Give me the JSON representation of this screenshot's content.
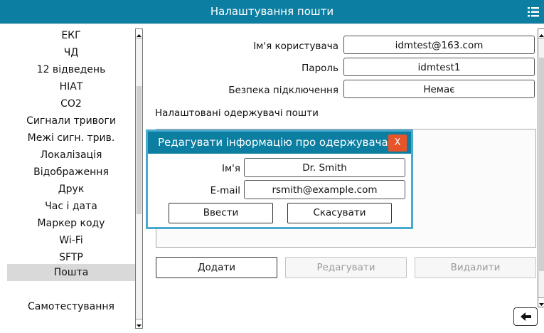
{
  "header": {
    "title": "Налаштування пошти",
    "menu_icon": "list-menu-icon"
  },
  "sidebar": {
    "items": [
      {
        "label": "ЕКГ"
      },
      {
        "label": "ЧД"
      },
      {
        "label": "12 відведень"
      },
      {
        "label": "НІАТ"
      },
      {
        "label": "CO2"
      },
      {
        "label": "Сигнали тривоги"
      },
      {
        "label": "Межі сигн. трив."
      },
      {
        "label": "Локалізація"
      },
      {
        "label": "Відображення"
      },
      {
        "label": "Друк"
      },
      {
        "label": "Час і дата"
      },
      {
        "label": "Маркер коду"
      },
      {
        "label": "Wi-Fi"
      },
      {
        "label": "SFTP"
      },
      {
        "label": "Пошта"
      },
      {
        "label": "Самотестування"
      }
    ],
    "active_item": "Пошта"
  },
  "account": {
    "username_label": "Ім'я користувача",
    "username_value": "idmtest@163.com",
    "password_label": "Пароль",
    "password_value": "idmtest1",
    "security_label": "Безпека підключення",
    "security_value": "Немає"
  },
  "recipients": {
    "section_title": "Налаштовані одержувачі пошти",
    "add_label": "Додати",
    "edit_label": "Редагувати",
    "delete_label": "Видалити"
  },
  "dialog": {
    "title": "Редагувати інформацію про одержувача",
    "close_label": "X",
    "name_label": "Ім'я",
    "name_value": "Dr. Smith",
    "email_label": "E-mail",
    "email_value": "rsmith@example.com",
    "enter_label": "Ввести",
    "cancel_label": "Скасувати"
  },
  "colors": {
    "title_bar": "#0b7ea1",
    "dialog_border": "#49a9cf",
    "close_button": "#e8542a",
    "selected_item": "#d9d9d9"
  },
  "footer": {
    "back_icon": "back-arrow-icon"
  }
}
